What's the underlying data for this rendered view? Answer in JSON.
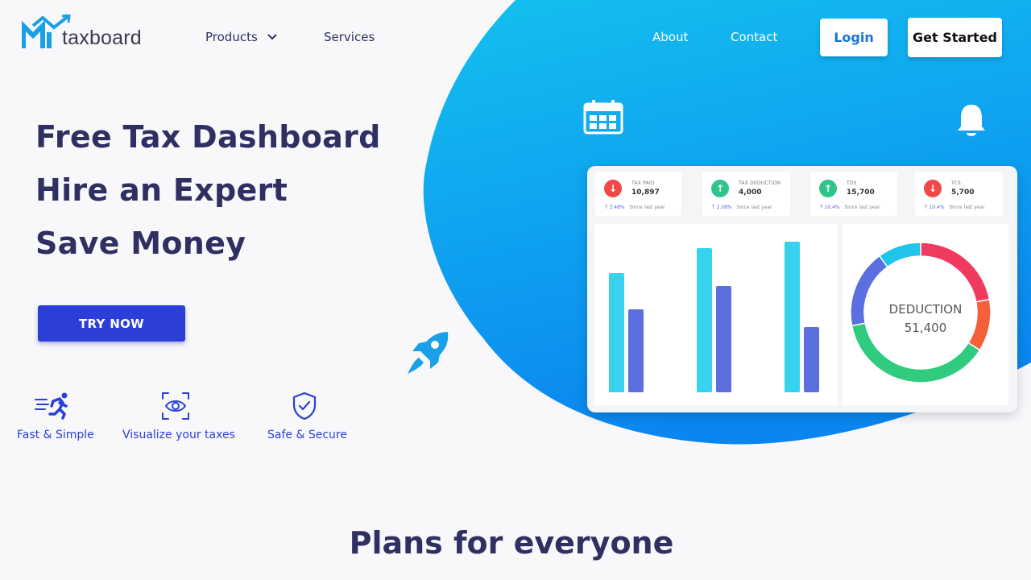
{
  "brand": {
    "name": "taxboard",
    "accent": "#2b3fd6",
    "hero_blue": "#12b4ee"
  },
  "nav": {
    "products": "Products",
    "services": "Services",
    "about": "About",
    "contact": "Contact",
    "login": "Login",
    "get_started": "Get Started"
  },
  "hero": {
    "line1": "Free Tax Dashboard",
    "line2": "Hire an Expert",
    "line3": "Save Money",
    "cta": "TRY NOW"
  },
  "features": [
    {
      "label": "Fast & Simple",
      "icon": "running-person-icon"
    },
    {
      "label": "Visualize your taxes",
      "icon": "eye-scan-icon"
    },
    {
      "label": "Safe & Secure",
      "icon": "shield-check-icon"
    }
  ],
  "dashboard": {
    "stats": [
      {
        "label": "TAX PAID",
        "value": "10,897",
        "pct": "3.48%",
        "since": "Since last year",
        "trend": "down",
        "color": "#f04747"
      },
      {
        "label": "TAX DEDUCTION",
        "value": "4,000",
        "pct": "2.08%",
        "since": "Since last year",
        "trend": "up",
        "color": "#2fc58a"
      },
      {
        "label": "TDS",
        "value": "15,700",
        "pct": "10.4%",
        "since": "Since last year",
        "trend": "up",
        "color": "#2fc58a"
      },
      {
        "label": "TCS",
        "value": "5,700",
        "pct": "10.4%",
        "since": "Since last year",
        "trend": "down",
        "color": "#f04747"
      }
    ],
    "bars": {
      "groups": 3,
      "series": [
        {
          "color": "#37d3ee",
          "values": [
            148,
            179,
            187
          ]
        },
        {
          "color": "#5b6fe0",
          "values": [
            103,
            132,
            81
          ]
        }
      ],
      "max": 200
    },
    "donut": {
      "title": "DEDUCTION",
      "value": "51,400",
      "segments": [
        {
          "color": "#f03a5f",
          "value": 22
        },
        {
          "color": "#f5603a",
          "value": 12
        },
        {
          "color": "#2fcc7f",
          "value": 38
        },
        {
          "color": "#5b6fe0",
          "value": 18
        },
        {
          "color": "#1ec4ea",
          "value": 10
        }
      ]
    }
  },
  "plans_heading": "Plans for everyone"
}
